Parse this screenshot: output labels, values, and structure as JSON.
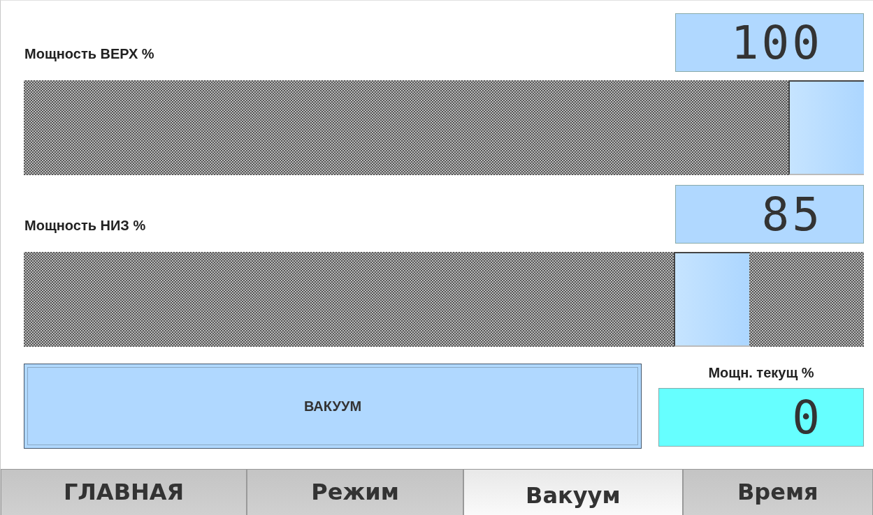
{
  "sliders": [
    {
      "label": "Мощность ВЕРХ %",
      "reading": "100",
      "level": 1
    },
    {
      "label": "Мощность НИЗ %",
      "reading": "85",
      "level": 0.85
    }
  ],
  "vacuum_button": {
    "label": "ВАКУУМ"
  },
  "current_power": {
    "label": "Мощн. текущ %",
    "reading": "0"
  },
  "tabs": [
    {
      "label": "ГЛАВНАЯ",
      "selected": false
    },
    {
      "label": "Режим",
      "selected": false
    },
    {
      "label": "Вакуум",
      "selected": true
    },
    {
      "label": "Время",
      "selected": false
    }
  ]
}
